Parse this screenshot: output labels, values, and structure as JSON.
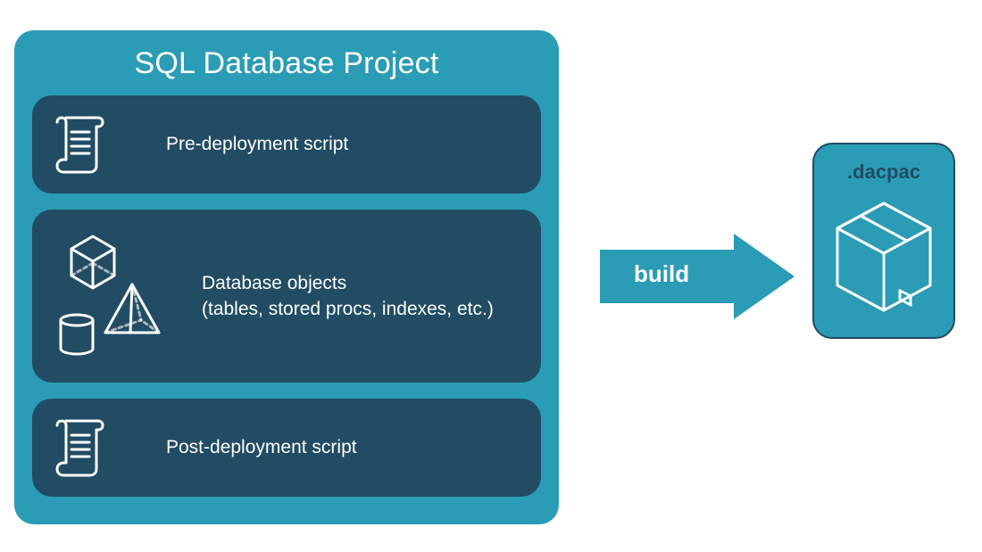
{
  "colors": {
    "outer_bg": "#2a9cb5",
    "inner_bg": "#214c64",
    "text_light": "#ffffff",
    "text_dark": "#214c64"
  },
  "project": {
    "title": "SQL Database Project",
    "pre_label": "Pre-deployment script",
    "objects_label_line1": "Database objects",
    "objects_label_line2": "(tables, stored procs, indexes, etc.)",
    "post_label": "Post-deployment script"
  },
  "arrow": {
    "label": "build"
  },
  "output": {
    "label": ".dacpac"
  }
}
